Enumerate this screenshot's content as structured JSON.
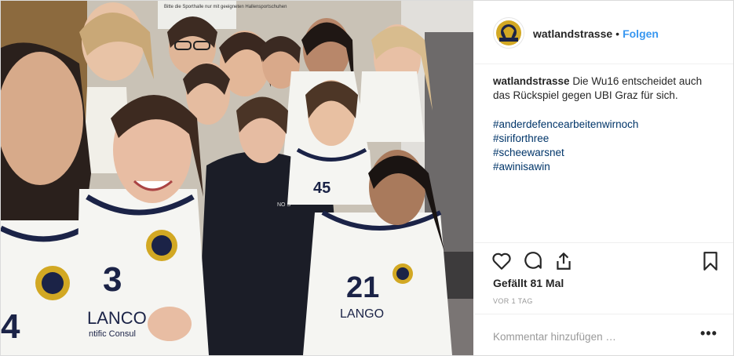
{
  "post": {
    "username": "watlandstrasse",
    "separator": "•",
    "follow_label": "Folgen",
    "caption_text": "Die Wu16 entscheidet auch das Rückspiel gegen UBI Graz für sich.",
    "hashtags": [
      "#anderdefencearbeitenwirnoch",
      "#siriforthree",
      "#scheewarsnet",
      "#awinisawin"
    ],
    "likes": "Gefällt 81 Mal",
    "time_ago": "VOR 1 TAG",
    "comment_placeholder": "Kommentar hinzufügen …",
    "more_label": "•••"
  },
  "photo": {
    "jersey_numbers": [
      "3",
      "21",
      "45",
      "4"
    ],
    "jersey_text": [
      "LANCO",
      "ntific Consul",
      "LANGO"
    ],
    "hoodie_text": "NO S",
    "wall_sign_text": "Bitte die Sporthalle nur mit geeigneten Hallensportschuhen"
  },
  "colors": {
    "accent_link": "#3897f0",
    "hashtag": "#003569",
    "jersey_navy": "#1b2347",
    "logo_gold": "#d2a823"
  },
  "icons": [
    "heart-icon",
    "comment-icon",
    "share-icon",
    "bookmark-icon",
    "more-options-icon"
  ]
}
